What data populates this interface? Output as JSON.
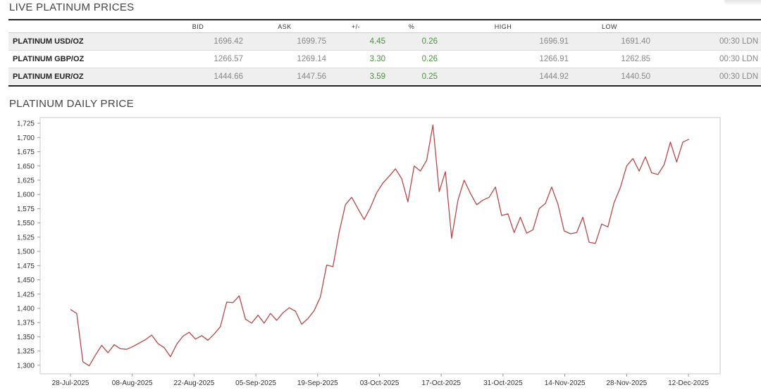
{
  "prices": {
    "title": "LIVE PLATINUM PRICES",
    "columns": [
      "",
      "BID",
      "ASK",
      "+/-",
      "%",
      "HIGH",
      "LOW",
      ""
    ],
    "rows": [
      {
        "name": "PLATINUM USD/OZ",
        "bid": "1696.42",
        "ask": "1699.75",
        "change": "4.45",
        "pct": "0.26",
        "high": "1696.91",
        "low": "1691.40",
        "time": "00:30 LDN"
      },
      {
        "name": "PLATINUM GBP/OZ",
        "bid": "1266.57",
        "ask": "1269.14",
        "change": "3.30",
        "pct": "0.26",
        "high": "1266.91",
        "low": "1262.85",
        "time": "00:30 LDN"
      },
      {
        "name": "PLATINUM EUR/OZ",
        "bid": "1444.66",
        "ask": "1447.56",
        "change": "3.59",
        "pct": "0.25",
        "high": "1444.92",
        "low": "1440.50",
        "time": "00:30 LDN"
      }
    ],
    "change_color": "#3e9a2e"
  },
  "chart_data": {
    "type": "line",
    "title": "PLATINUM DAILY PRICE",
    "xlabel": "",
    "ylabel": "",
    "ylim": [
      1285,
      1735
    ],
    "yticks": [
      1300,
      1325,
      1350,
      1375,
      1400,
      1425,
      1450,
      1475,
      1500,
      1525,
      1550,
      1575,
      1600,
      1625,
      1650,
      1675,
      1700,
      1725
    ],
    "yticklabels": [
      "1,300",
      "1,325",
      "1,350",
      "1,375",
      "1,400",
      "1,425",
      "1,450",
      "1,475",
      "1,500",
      "1,525",
      "1,550",
      "1,575",
      "1,600",
      "1,625",
      "1,650",
      "1,675",
      "1,700",
      "1,725"
    ],
    "xticklabels": [
      "28-Jul-2025",
      "08-Aug-2025",
      "22-Aug-2025",
      "05-Sep-2025",
      "19-Sep-2025",
      "03-Oct-2025",
      "17-Oct-2025",
      "31-Oct-2025",
      "14-Nov-2025",
      "28-Nov-2025",
      "12-Dec-2025"
    ],
    "grid": false,
    "line_color": "#b54848",
    "series": [
      {
        "values": [
          1398,
          1391,
          1306,
          1299,
          1318,
          1335,
          1322,
          1336,
          1329,
          1328,
          1333,
          1339,
          1345,
          1353,
          1338,
          1331,
          1315,
          1337,
          1351,
          1358,
          1346,
          1352,
          1344,
          1355,
          1368,
          1411,
          1410,
          1422,
          1381,
          1374,
          1388,
          1374,
          1391,
          1379,
          1392,
          1401,
          1395,
          1372,
          1382,
          1396,
          1420,
          1476,
          1473,
          1534,
          1582,
          1595,
          1575,
          1556,
          1577,
          1603,
          1620,
          1632,
          1645,
          1628,
          1587,
          1650,
          1641,
          1660,
          1722,
          1605,
          1640,
          1523,
          1590,
          1625,
          1602,
          1582,
          1590,
          1595,
          1613,
          1563,
          1566,
          1533,
          1560,
          1532,
          1538,
          1575,
          1584,
          1613,
          1583,
          1536,
          1531,
          1533,
          1560,
          1516,
          1514,
          1548,
          1543,
          1586,
          1612,
          1650,
          1663,
          1641,
          1666,
          1638,
          1635,
          1652,
          1692,
          1657,
          1692,
          1697
        ]
      }
    ]
  }
}
